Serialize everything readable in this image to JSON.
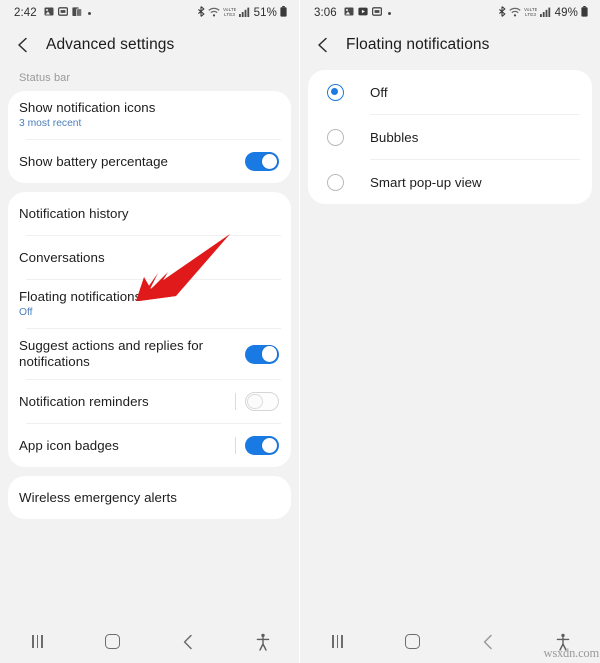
{
  "colors": {
    "accent_blue": "#1a7ae4",
    "subtitle_blue": "#4a7fbd",
    "card_white": "#ffffff",
    "page_bg": "#f2f2f2",
    "arrow_red": "#e0191a",
    "text_primary": "#1d1d1d",
    "text_muted": "#9a9a9a"
  },
  "left_screen": {
    "status_bar": {
      "time": "2:42",
      "left_icons": [
        "gallery-icon",
        "screen-recorder-icon",
        "multi-window-icon",
        "notification-dot-icon"
      ],
      "right_icons": [
        "bluetooth-icon",
        "wifi-icon",
        "volte-icon",
        "signal-bars-icon"
      ],
      "battery_percent": "51%",
      "battery_icon": "battery-icon"
    },
    "header": {
      "back_icon": "back-chevron-icon",
      "title": "Advanced settings"
    },
    "section_label": "Status bar",
    "groups": [
      {
        "rows": [
          {
            "title": "Show notification icons",
            "subtitle": "3 most recent",
            "control": "none"
          },
          {
            "title": "Show battery percentage",
            "subtitle": "",
            "control": "toggle",
            "toggle_state": "on",
            "divider_before_toggle": false
          }
        ]
      },
      {
        "rows": [
          {
            "title": "Notification history",
            "subtitle": "",
            "control": "none"
          },
          {
            "title": "Conversations",
            "subtitle": "",
            "control": "none"
          },
          {
            "title": "Floating notifications",
            "subtitle": "Off",
            "control": "none"
          },
          {
            "title": "Suggest actions and replies for notifications",
            "subtitle": "",
            "control": "toggle",
            "toggle_state": "on",
            "divider_before_toggle": false
          },
          {
            "title": "Notification reminders",
            "subtitle": "",
            "control": "toggle",
            "toggle_state": "off",
            "divider_before_toggle": true
          },
          {
            "title": "App icon badges",
            "subtitle": "",
            "control": "toggle",
            "toggle_state": "on",
            "divider_before_toggle": true
          }
        ]
      },
      {
        "rows": [
          {
            "title": "Wireless emergency alerts",
            "subtitle": "",
            "control": "none"
          }
        ]
      }
    ],
    "annotation": {
      "type": "arrow",
      "direction": "down-left",
      "color": "#e0191a",
      "points_at": "Floating notifications"
    },
    "navbar": {
      "recents": "recents-icon",
      "home": "home-icon",
      "back": "back-icon",
      "accessibility": "accessibility-icon"
    }
  },
  "right_screen": {
    "status_bar": {
      "time": "3:06",
      "left_icons": [
        "gallery-icon",
        "video-player-icon",
        "screen-recorder-icon",
        "notification-dot-icon"
      ],
      "right_icons": [
        "bluetooth-icon",
        "wifi-icon",
        "volte-icon",
        "signal-bars-icon"
      ],
      "battery_percent": "49%",
      "battery_icon": "battery-icon"
    },
    "header": {
      "back_icon": "back-chevron-icon",
      "title": "Floating notifications"
    },
    "options": [
      {
        "label": "Off",
        "selected": true
      },
      {
        "label": "Bubbles",
        "selected": false
      },
      {
        "label": "Smart pop-up view",
        "selected": false
      }
    ],
    "navbar": {
      "recents": "recents-icon",
      "home": "home-icon",
      "back": "back-icon",
      "accessibility": "accessibility-icon"
    },
    "watermark": "wsxdn.com"
  }
}
